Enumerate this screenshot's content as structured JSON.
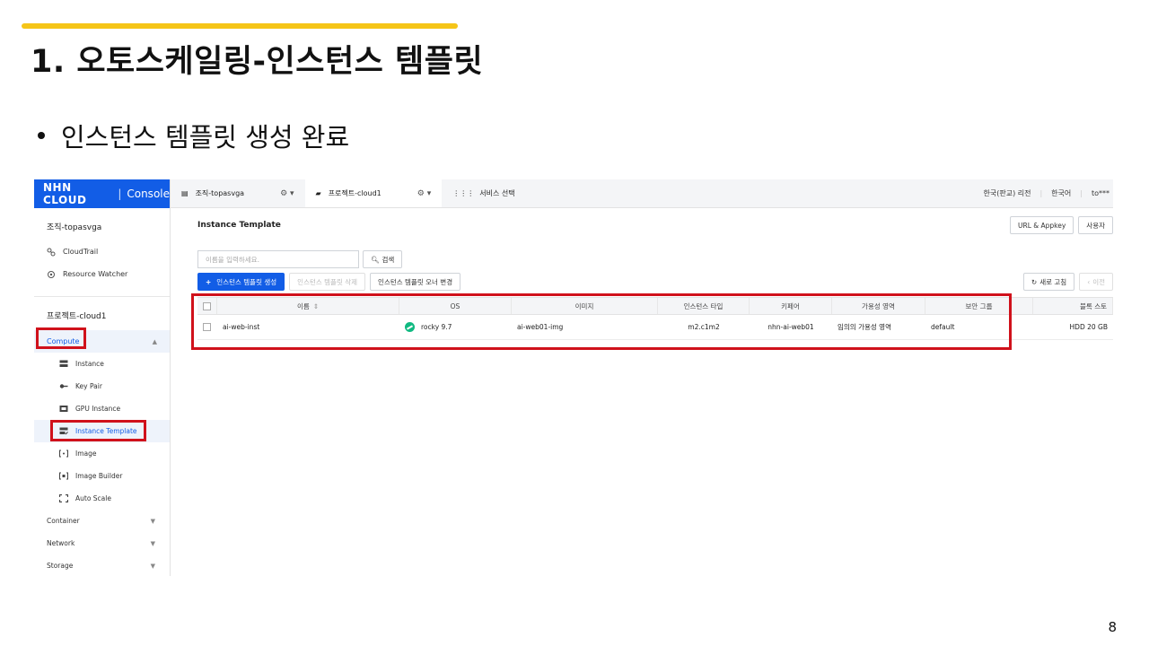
{
  "slide": {
    "title": "1. 오토스케일링-인스턴스 템플릿",
    "bullet": "인스턴스 템플릿 생성 완료",
    "page_number": "8",
    "accent_color": "#f5c518",
    "highlight_color": "#d0111b"
  },
  "console": {
    "brand": {
      "logo": "NHN CLOUD",
      "separator": "|",
      "product": "Console",
      "color": "#125de6"
    },
    "sidebar": {
      "org_name": "조직-topasvga",
      "org_items": [
        {
          "label": "CloudTrail",
          "icon": "cloudtrail-icon"
        },
        {
          "label": "Resource Watcher",
          "icon": "resource-watcher-icon"
        }
      ],
      "project_name": "프로젝트-cloud1",
      "compute": {
        "label": "Compute",
        "expanded": true
      },
      "compute_items": [
        {
          "label": "Instance",
          "icon": "instance-icon"
        },
        {
          "label": "Key Pair",
          "icon": "key-pair-icon"
        },
        {
          "label": "GPU Instance",
          "icon": "gpu-icon"
        },
        {
          "label": "Instance Template",
          "icon": "template-icon",
          "active": true
        },
        {
          "label": "Image",
          "icon": "image-icon"
        },
        {
          "label": "Image Builder",
          "icon": "image-builder-icon"
        },
        {
          "label": "Auto Scale",
          "icon": "auto-scale-icon"
        }
      ],
      "categories": [
        "Container",
        "Network",
        "Storage"
      ]
    },
    "topnav": {
      "org_tab": "조직-topasvga",
      "project_tab": "프로젝트-cloud1",
      "service_tab": "서비스 선택",
      "region": "한국(판교) 리전",
      "language": "한국어",
      "user": "to***"
    },
    "page_title": "Instance Template",
    "top_buttons": {
      "url_appkey": "URL & Appkey",
      "user_guide": "사용자"
    },
    "search": {
      "placeholder": "이름을 입력하세요.",
      "button": "검색"
    },
    "actions": {
      "create": "인스턴스 템플릿 생성",
      "delete": "인스턴스 템플릿 삭제",
      "change_owner": "인스턴스 템플릿 오너 변경",
      "refresh": "새로 고침",
      "prev": "이전"
    },
    "table": {
      "headers": [
        "이름",
        "OS",
        "이미지",
        "인스턴스 타입",
        "키페어",
        "가용성 영역",
        "보안 그룹",
        "블록 스토"
      ],
      "rows": [
        {
          "name": "ai-web-inst",
          "os": "rocky 9.7",
          "image": "ai-web01-img",
          "instance_type": "m2.c1m2",
          "keypair": "nhn-ai-web01",
          "availability_zone": "임의의 가용성 영역",
          "security_group": "default",
          "block_storage": "HDD 20 GB"
        }
      ]
    }
  }
}
